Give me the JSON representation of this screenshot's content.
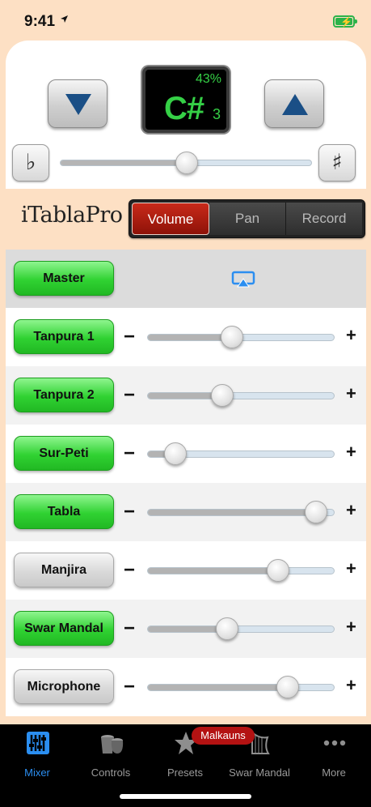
{
  "status": {
    "time": "9:41"
  },
  "tuner": {
    "down_icon": "triangle-down-icon",
    "up_icon": "triangle-up-icon",
    "percent": "43%",
    "note": "C#",
    "octave": "3",
    "flat_label": "♭",
    "sharp_label": "♯",
    "pitch_level": 0.5
  },
  "app": {
    "logo": "iTablaPro"
  },
  "mode_tabs": [
    {
      "label": "Volume",
      "selected": true
    },
    {
      "label": "Pan",
      "selected": false
    },
    {
      "label": "Record",
      "selected": false
    }
  ],
  "mixer": {
    "master_label": "Master",
    "channels": [
      {
        "label": "Tanpura 1",
        "on": true,
        "level": 0.44
      },
      {
        "label": "Tanpura 2",
        "on": true,
        "level": 0.38
      },
      {
        "label": "Sur-Peti",
        "on": true,
        "level": 0.1
      },
      {
        "label": "Tabla",
        "on": true,
        "level": 0.95
      },
      {
        "label": "Manjira",
        "on": false,
        "level": 0.72
      },
      {
        "label": "Swar Mandal",
        "on": true,
        "level": 0.41
      },
      {
        "label": "Microphone",
        "on": false,
        "level": 0.78
      }
    ],
    "minus_label": "−",
    "plus_label": "+"
  },
  "tabbar": {
    "items": [
      {
        "label": "Mixer",
        "icon": "mixer-icon",
        "active": true
      },
      {
        "label": "Controls",
        "icon": "tabla-drums-icon",
        "active": false
      },
      {
        "label": "Presets",
        "icon": "star-icon",
        "active": false
      },
      {
        "label": "Swar Mandal",
        "icon": "harp-icon",
        "active": false
      },
      {
        "label": "More",
        "icon": "more-dots-icon",
        "active": false
      }
    ],
    "badge": "Malkauns"
  },
  "colors": {
    "accent": "#2b8ef0",
    "channel_on": "#30d232",
    "note_green": "#35d046",
    "segment_active": "#b41e10"
  }
}
